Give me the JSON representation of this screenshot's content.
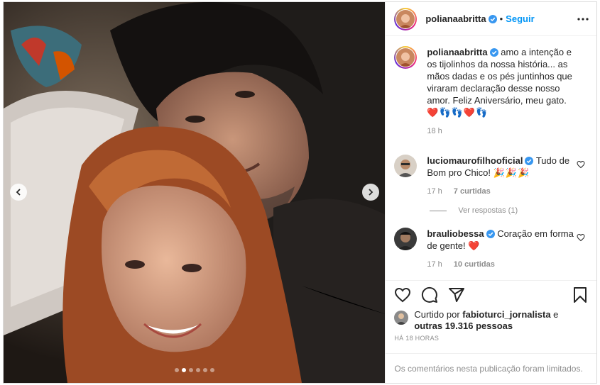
{
  "post": {
    "author": "polianaabritta",
    "follow_label": "Seguir",
    "separator": "•",
    "carousel": {
      "slide_count": 6,
      "active_index": 1
    }
  },
  "caption": {
    "author": "polianaabritta",
    "text": "amo a intenção e os tijolinhos da nossa história... as mãos dadas e os pés juntinhos que viraram declaração desse nosso amor. Feliz Aniversário, meu gato.",
    "emoji": "❤️👣👣❤️👣",
    "time": "18 h"
  },
  "comments": [
    {
      "author": "luciomaurofilhooficial",
      "text": "Tudo de Bom pro Chico!",
      "emoji": "🎉🎉🎉",
      "time": "17 h",
      "likes": "7 curtidas",
      "replies": "Ver respostas (1)"
    },
    {
      "author": "brauliobessa",
      "text": "Coração em forma de gente!",
      "emoji": "❤️",
      "time": "17 h",
      "likes": "10 curtidas"
    }
  ],
  "likes": {
    "prefix": "Curtido por",
    "user": "fabioturci_jornalista",
    "connector": "e",
    "others": "outras 19.316 pessoas"
  },
  "timestamp": "HÁ 18 HORAS",
  "comments_limited": "Os comentários nesta publicação foram limitados.",
  "colors": {
    "link_blue": "#0095f6",
    "muted": "#8e8e8e",
    "verified": "#3897f0",
    "heart_red": "#ed4956"
  }
}
